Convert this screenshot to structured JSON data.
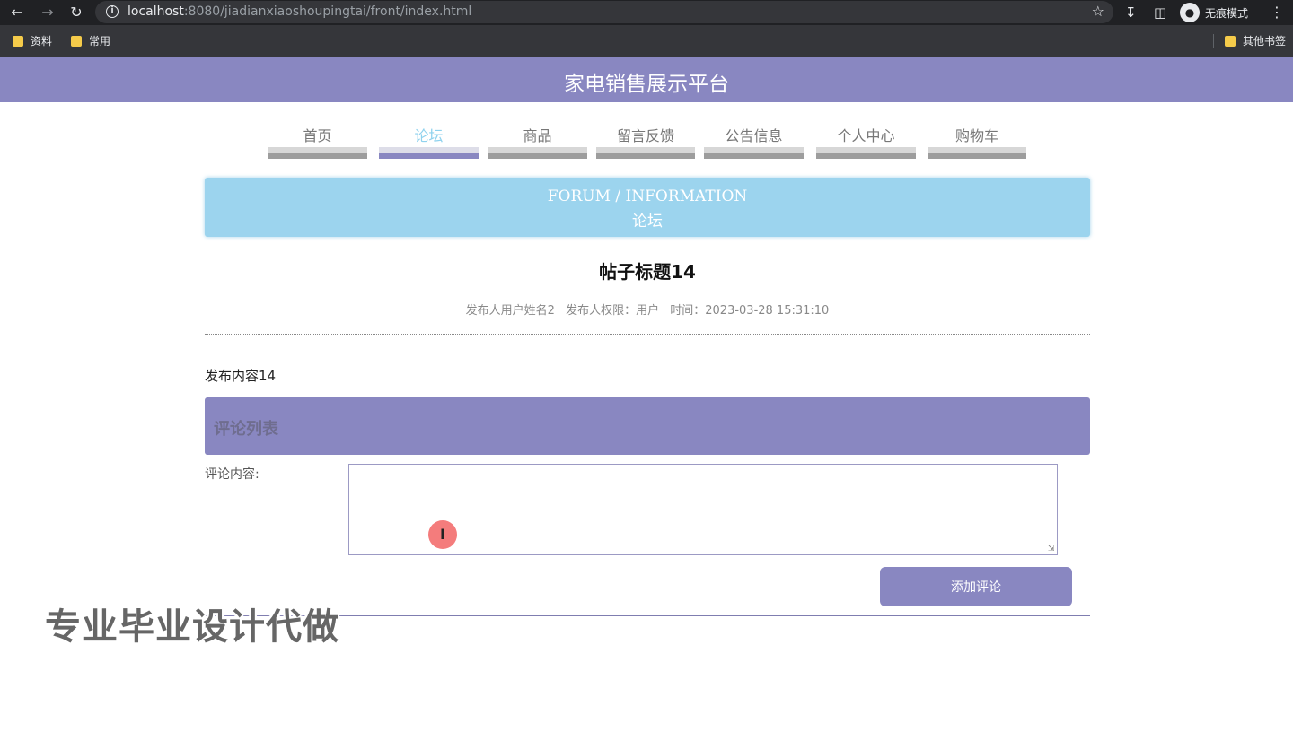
{
  "browser": {
    "url_host": "localhost",
    "url_path": ":8080/jiadianxiaoshoupingtai/front/index.html",
    "incognito_label": "无痕模式",
    "bookmarks": [
      {
        "label": "资料"
      },
      {
        "label": "常用"
      }
    ],
    "other_bookmarks": "其他书签"
  },
  "site": {
    "title": "家电销售展示平台"
  },
  "nav": {
    "items": [
      {
        "label": "首页",
        "active": false
      },
      {
        "label": "论坛",
        "active": true
      },
      {
        "label": "商品",
        "active": false
      },
      {
        "label": "留言反馈",
        "active": false
      },
      {
        "label": "公告信息",
        "active": false
      },
      {
        "label": "个人中心",
        "active": false
      },
      {
        "label": "购物车",
        "active": false
      }
    ]
  },
  "banner": {
    "english": "FORUM / INFORMATION",
    "chinese": "论坛"
  },
  "post": {
    "title": "帖子标题14",
    "author": "发布人用户姓名2",
    "role": "发布人权限：用户",
    "time": "时间：2023-03-28 15:31:10",
    "content": "发布内容14"
  },
  "comments": {
    "header": "评论列表",
    "form_label": "评论内容:",
    "textarea_value": "",
    "add_button": "添加评论"
  },
  "overlay": {
    "watermark": "专业毕业设计代做",
    "cursor_glyph": "I"
  },
  "colors": {
    "accent": "#8987c1",
    "banner": "#9cd4ee",
    "active_nav": "#8fd2ee"
  }
}
